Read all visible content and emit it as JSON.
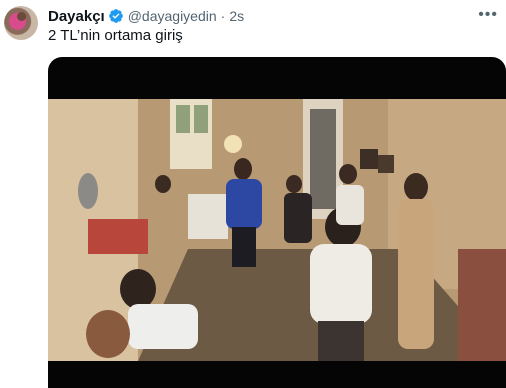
{
  "tweet": {
    "author_name": "Dayakçı",
    "handle": "@dayagiyedin",
    "separator": "·",
    "time": "2s",
    "text": "2 TL’nin ortama giriş",
    "more_icon": "more-horizontal-icon",
    "verified_icon": "verified-badge-icon"
  },
  "colors": {
    "verified": "#1d9bf0",
    "text_primary": "#0f1419",
    "text_secondary": "#536471",
    "media_frame": "#050505"
  }
}
